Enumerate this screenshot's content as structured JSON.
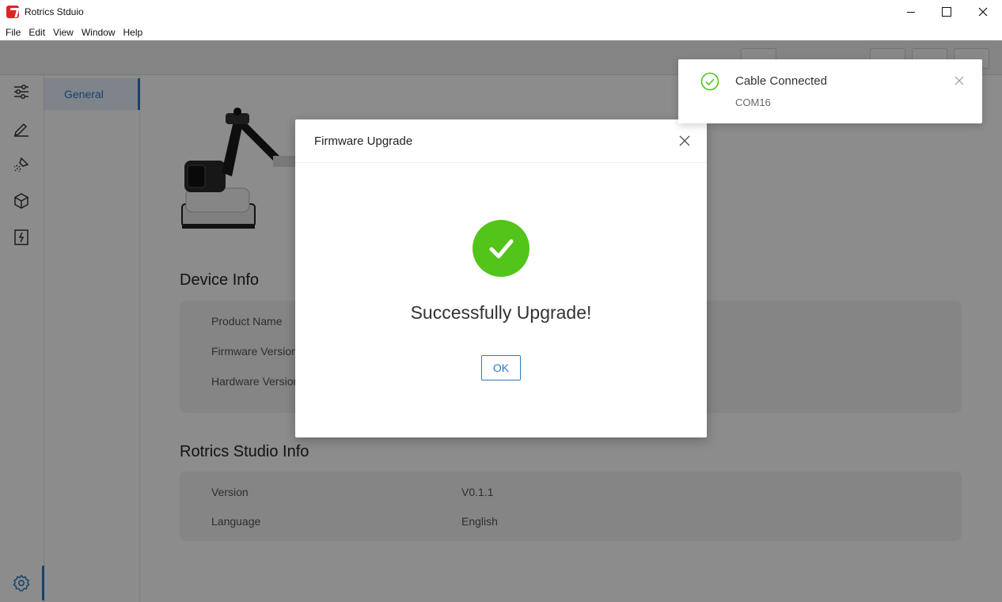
{
  "window": {
    "title": "Rotrics Stduio"
  },
  "menu": [
    "File",
    "Edit",
    "View",
    "Window",
    "Help"
  ],
  "subnav": {
    "active": "General"
  },
  "device_info": {
    "title": "Device Info",
    "rows": [
      {
        "label": "Product Name"
      },
      {
        "label": "Firmware Version"
      },
      {
        "label": "Hardware Version"
      }
    ]
  },
  "studio_info": {
    "title": "Rotrics Studio Info",
    "rows": [
      {
        "label": "Version",
        "value": "V0.1.1"
      },
      {
        "label": "Language",
        "value": "English"
      }
    ]
  },
  "modal": {
    "title": "Firmware Upgrade",
    "message": "Successfully Upgrade!",
    "ok_label": "OK"
  },
  "notification": {
    "title": "Cable Connected",
    "description": "COM16"
  },
  "colors": {
    "accent": "#2a78c5",
    "success": "#52c41a",
    "logo": "#e02424"
  }
}
